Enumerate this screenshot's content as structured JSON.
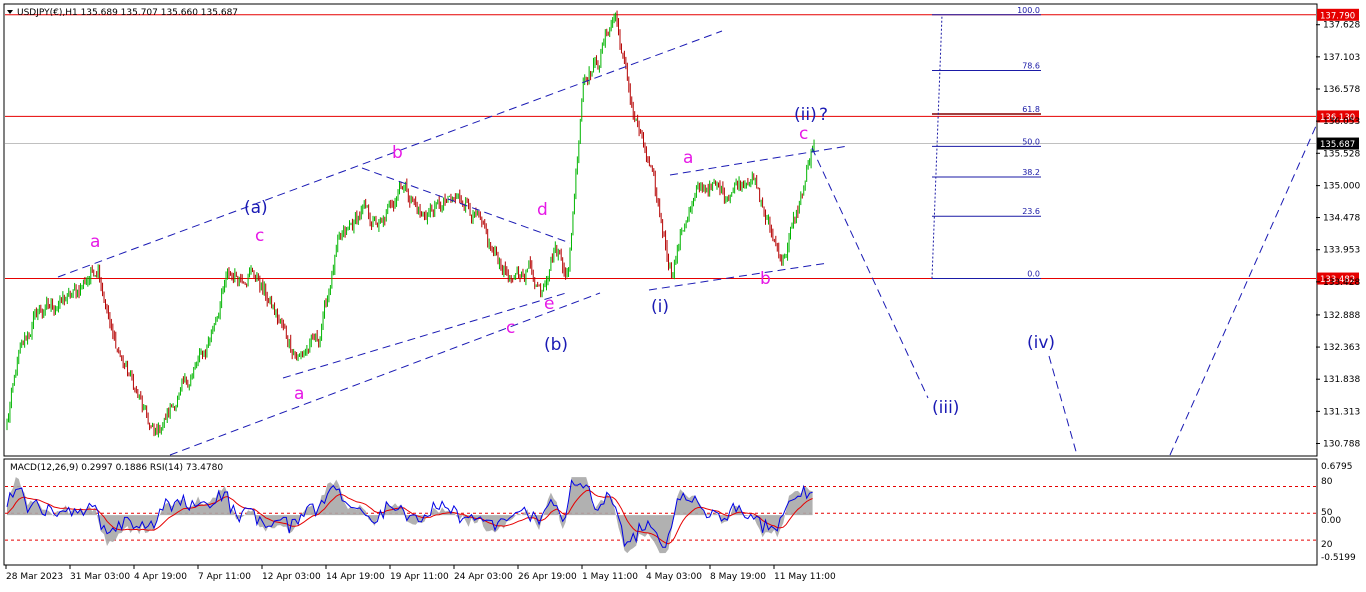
{
  "header": {
    "symbol_line": "USDJPY(€),H1  135.689 135.707 135.660 135.687",
    "indicator_line": "MACD(12,26,9) 0.2997 0.1886  RSI(14) 73.4780"
  },
  "colors": {
    "bull": "#00b400",
    "bear": "#b40000",
    "wave_blue": "#1a1ab4",
    "wave_magenta": "#e619e6",
    "level_red": "#e60000",
    "macd_fill": "#a8a8a8",
    "rsi_line": "#0000e6",
    "signal_line": "#e60000",
    "current_price_bg": "#000000"
  },
  "chart_data": {
    "type": "candlestick",
    "symbol": "USDJPY(€)",
    "timeframe": "H1",
    "ohlc_last": {
      "open": 135.689,
      "high": 135.707,
      "low": 135.66,
      "close": 135.687
    },
    "ylim": [
      130.6,
      137.95
    ],
    "price_ticks": [
      "137.628",
      "137.103",
      "136.578",
      "136.053",
      "135.528",
      "135.000",
      "134.478",
      "133.953",
      "133.428",
      "132.888",
      "132.363",
      "131.838",
      "131.313",
      "130.788"
    ],
    "time_ticks": [
      "28 Mar 2023",
      "31 Mar 03:00",
      "4 Apr 19:00",
      "7 Apr 11:00",
      "12 Apr 03:00",
      "14 Apr 19:00",
      "19 Apr 11:00",
      "24 Apr 03:00",
      "26 Apr 19:00",
      "1 May 11:00",
      "4 May 03:00",
      "8 May 19:00",
      "11 May 11:00"
    ],
    "key_points": [
      {
        "bar": 0,
        "price": 131.1
      },
      {
        "bar": 8,
        "price": 132.2
      },
      {
        "bar": 20,
        "price": 132.9
      },
      {
        "bar": 45,
        "price": 133.2
      },
      {
        "bar": 62,
        "price": 133.7
      },
      {
        "bar": 72,
        "price": 132.5
      },
      {
        "bar": 85,
        "price": 131.8
      },
      {
        "bar": 100,
        "price": 130.9
      },
      {
        "bar": 118,
        "price": 131.6
      },
      {
        "bar": 135,
        "price": 132.3
      },
      {
        "bar": 150,
        "price": 133.5
      },
      {
        "bar": 168,
        "price": 133.6
      },
      {
        "bar": 180,
        "price": 133.0
      },
      {
        "bar": 198,
        "price": 132.2
      },
      {
        "bar": 212,
        "price": 132.5
      },
      {
        "bar": 225,
        "price": 134.0
      },
      {
        "bar": 242,
        "price": 134.6
      },
      {
        "bar": 255,
        "price": 134.3
      },
      {
        "bar": 268,
        "price": 135.1
      },
      {
        "bar": 282,
        "price": 134.5
      },
      {
        "bar": 298,
        "price": 134.7
      },
      {
        "bar": 312,
        "price": 134.8
      },
      {
        "bar": 328,
        "price": 134.0
      },
      {
        "bar": 345,
        "price": 133.4
      },
      {
        "bar": 355,
        "price": 133.7
      },
      {
        "bar": 363,
        "price": 133.3
      },
      {
        "bar": 372,
        "price": 134.0
      },
      {
        "bar": 382,
        "price": 133.6
      },
      {
        "bar": 392,
        "price": 136.8
      },
      {
        "bar": 402,
        "price": 137.0
      },
      {
        "bar": 410,
        "price": 137.6
      },
      {
        "bar": 414,
        "price": 137.8
      },
      {
        "bar": 418,
        "price": 137.2
      },
      {
        "bar": 426,
        "price": 136.2
      },
      {
        "bar": 438,
        "price": 135.2
      },
      {
        "bar": 452,
        "price": 133.6
      },
      {
        "bar": 462,
        "price": 134.5
      },
      {
        "bar": 474,
        "price": 135.0
      },
      {
        "bar": 490,
        "price": 134.9
      },
      {
        "bar": 506,
        "price": 135.2
      },
      {
        "bar": 520,
        "price": 134.2
      },
      {
        "bar": 528,
        "price": 133.8
      },
      {
        "bar": 538,
        "price": 134.6
      },
      {
        "bar": 549,
        "price": 135.687
      }
    ],
    "horizontal_levels": [
      {
        "price": 137.79,
        "label": "137.790"
      },
      {
        "price": 136.13,
        "label": "136.130"
      },
      {
        "price": 133.482,
        "label": "133.482"
      }
    ],
    "current_price": {
      "price": 135.687,
      "label": "135.687"
    },
    "fib_levels": [
      {
        "label": "100.0",
        "price": 137.79
      },
      {
        "label": "78.6",
        "price": 136.88
      },
      {
        "label": "61.8",
        "price": 136.17
      },
      {
        "label": "50.0",
        "price": 135.64
      },
      {
        "label": "38.2",
        "price": 135.14
      },
      {
        "label": "23.6",
        "price": 134.5
      },
      {
        "label": "0.0",
        "price": 133.482
      }
    ],
    "wave_labels_blue": [
      "(a)",
      "(b)",
      "(i)",
      "(ii)",
      "?",
      "(iii)",
      "(iv)"
    ],
    "wave_labels_magenta": [
      "a",
      "b",
      "c",
      "a",
      "b",
      "c",
      "d",
      "e",
      "a",
      "b",
      "c"
    ],
    "projection_points": [
      {
        "bar": 555,
        "price": 135.65
      },
      {
        "bar": 640,
        "price": 131.7
      },
      {
        "bar": 678,
        "price": 130.6
      }
    ],
    "projection_points_2": [
      {
        "bar": 760,
        "price": 130.6
      },
      {
        "bar": 900,
        "price": 136.2
      }
    ],
    "indicator": {
      "macd": {
        "fast": 12,
        "slow": 26,
        "signal": 9,
        "main": 0.2997,
        "signal_value": 0.1886
      },
      "rsi": {
        "period": 14,
        "value": 73.478
      },
      "right_labels": [
        "0.6795",
        "80",
        "50",
        "0.00",
        "20",
        "-0.5199"
      ]
    }
  }
}
